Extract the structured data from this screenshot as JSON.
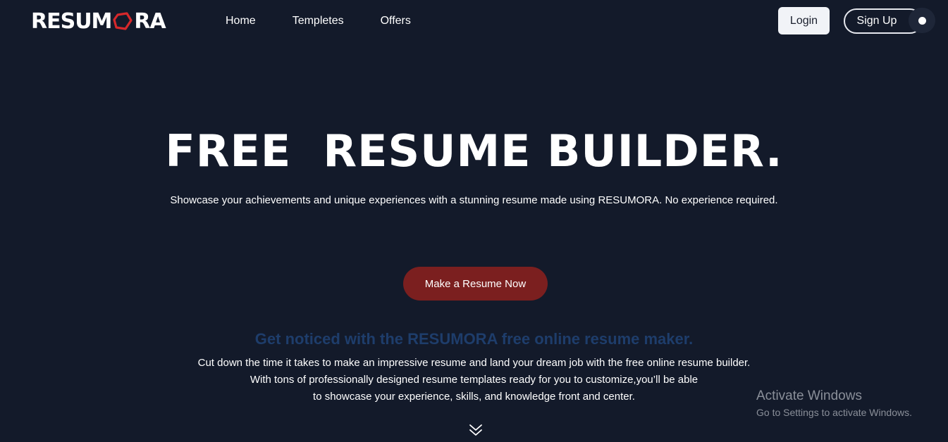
{
  "brand": {
    "name_prefix": "RESUM",
    "name_suffix": "RA",
    "mark_color": "#d6282b"
  },
  "nav": {
    "links": [
      {
        "label": "Home"
      },
      {
        "label": "Templetes"
      },
      {
        "label": "Offers"
      }
    ],
    "login_label": "Login",
    "signup_label": "Sign Up",
    "theme_toggle_icon": "toggle-knob-icon"
  },
  "hero": {
    "title": "FREE  RESUME BUILDER.",
    "subtitle": "Showcase your achievements and unique experiences with a stunning resume made using RESUMORA. No experience required.",
    "cta_label": "Make a Resume Now",
    "cta_color": "#7b1f1f"
  },
  "section": {
    "heading": "Get noticed with the RESUMORA free online resume maker.",
    "heading_color": "#1e3d6b",
    "lines": [
      "Cut down the time it takes to make an impressive resume and land your dream job with the free online resume builder.",
      "With tons of professionally designed resume templates ready for you to customize,you’ll be able",
      "to showcase your experience, skills, and knowledge front and center."
    ],
    "scroll_icon": "double-chevron-down-icon"
  },
  "watermark": {
    "title": "Activate Windows",
    "subtitle": "Go to Settings to activate Windows."
  },
  "colors": {
    "background": "#131a2a",
    "login_bg": "#f1f3f7"
  }
}
